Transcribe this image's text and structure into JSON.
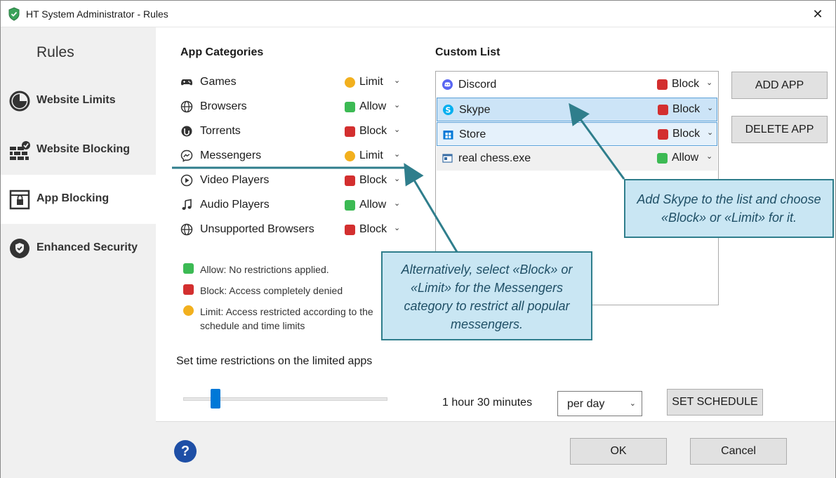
{
  "window": {
    "title": "HT System Administrator - Rules",
    "close_icon": "close-icon"
  },
  "sidebar": {
    "title": "Rules",
    "items": [
      {
        "label": "Website Limits",
        "icon": "clock-icon"
      },
      {
        "label": "Website Blocking",
        "icon": "brick-wall-icon"
      },
      {
        "label": "App Blocking",
        "icon": "app-lock-icon",
        "active": true
      },
      {
        "label": "Enhanced Security",
        "icon": "shield-check-icon"
      }
    ]
  },
  "categories": {
    "heading": "App Categories",
    "items": [
      {
        "label": "Games",
        "icon": "gamepad-icon",
        "status": "Limit"
      },
      {
        "label": "Browsers",
        "icon": "globe-icon",
        "status": "Allow"
      },
      {
        "label": "Torrents",
        "icon": "torrent-icon",
        "status": "Block"
      },
      {
        "label": "Messengers",
        "icon": "messenger-icon",
        "status": "Limit"
      },
      {
        "label": "Video Players",
        "icon": "play-icon",
        "status": "Block"
      },
      {
        "label": "Audio Players",
        "icon": "music-note-icon",
        "status": "Allow"
      },
      {
        "label": "Unsupported Browsers",
        "icon": "globe-icon",
        "status": "Block"
      }
    ]
  },
  "legend": {
    "allow": "Allow: No restrictions applied.",
    "block": "Block: Access completely denied",
    "limit": "Limit: Access restricted according to the schedule and time limits"
  },
  "custom_list": {
    "heading": "Custom List",
    "apps": [
      {
        "name": "Discord",
        "icon": "discord-icon",
        "status": "Block"
      },
      {
        "name": "Skype",
        "icon": "skype-icon",
        "status": "Block"
      },
      {
        "name": "Store",
        "icon": "store-icon",
        "status": "Block"
      },
      {
        "name": "real chess.exe",
        "icon": "exe-window-icon",
        "status": "Allow"
      }
    ],
    "add_button": "ADD APP",
    "delete_button": "DELETE APP"
  },
  "time": {
    "label": "Set time restrictions on the limited apps",
    "value": "1 hour 30 minutes",
    "slider_fraction": 0.16,
    "period": "per day",
    "schedule_button": "SET SCHEDULE"
  },
  "footer": {
    "help": "?",
    "ok": "OK",
    "cancel": "Cancel"
  },
  "callouts": {
    "skype": "Add Skype to the list and choose «Block» or «Limit» for it.",
    "messengers": "Alternatively, select «Block» or «Limit» for the Messengers category to restrict all popular messengers."
  },
  "colors": {
    "allow": "#3cba54",
    "block": "#d32f2f",
    "limit": "#f2b01e",
    "accent": "#0078d7",
    "callout_bg": "#c9e6f3",
    "callout_border": "#2f7e8c"
  }
}
